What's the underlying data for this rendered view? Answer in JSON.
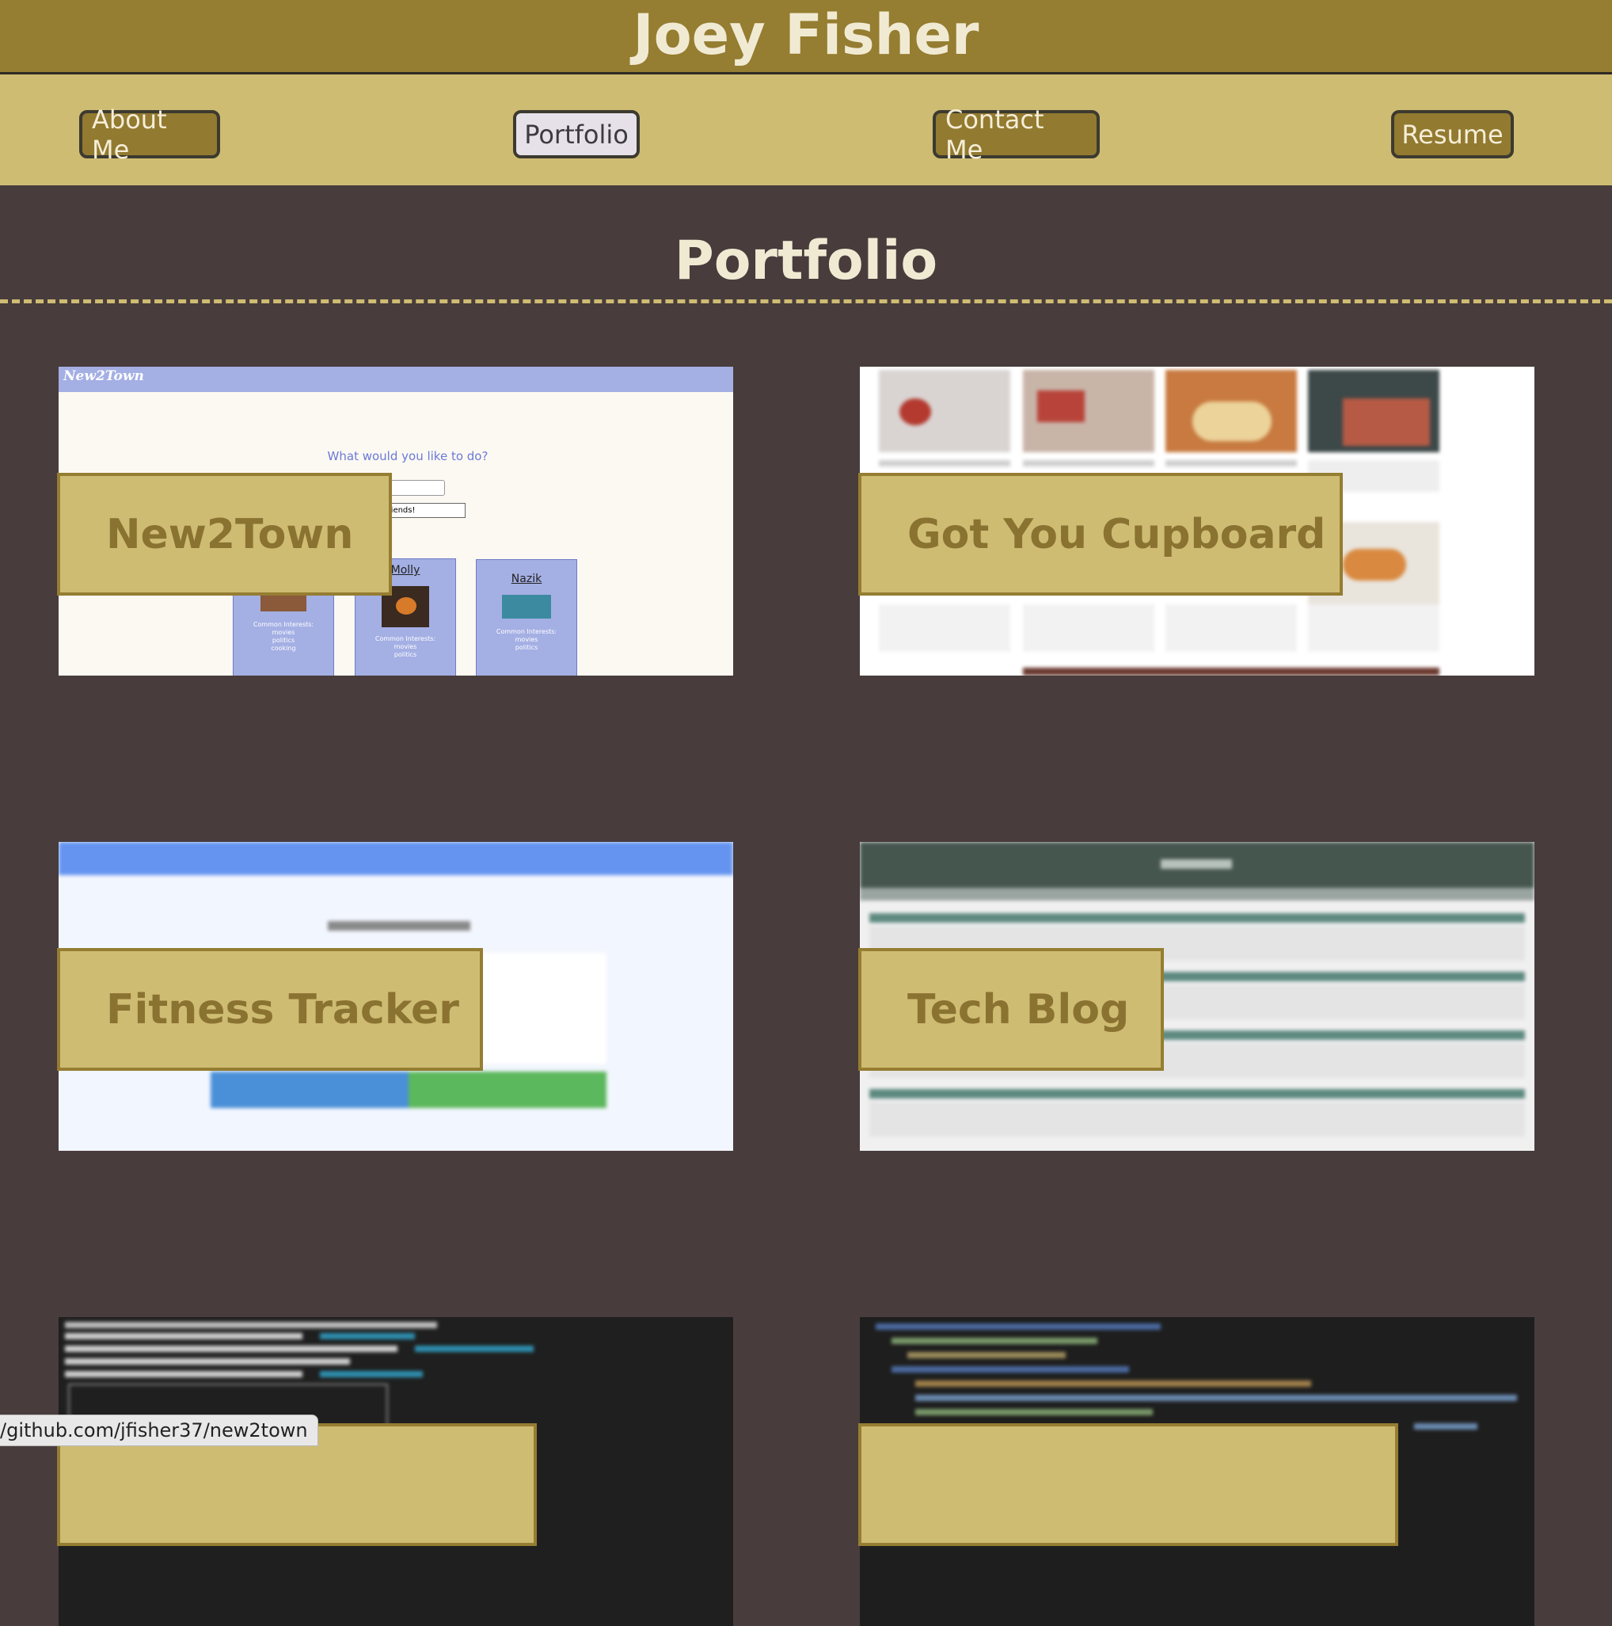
{
  "header": {
    "name": "Joey Fisher"
  },
  "nav": {
    "items": [
      {
        "label": "About Me",
        "active": false
      },
      {
        "label": "Portfolio",
        "active": true
      },
      {
        "label": "Contact Me",
        "active": false
      },
      {
        "label": "Resume",
        "active": false
      }
    ]
  },
  "section": {
    "title": "Portfolio"
  },
  "projects": [
    {
      "title": "New2Town",
      "preview": {
        "logo": "New2Town",
        "question": "What would you like to do?",
        "button": "d Friends!",
        "cards": [
          {
            "name": "Molly",
            "interests": "Common Interests:",
            "items": [
              "movies",
              "politics"
            ]
          },
          {
            "name": "Nazik",
            "interests": "Common Interests:",
            "items": [
              "movies",
              "politics"
            ]
          },
          {
            "name": "",
            "interests": "Common Interests:",
            "items": [
              "movies",
              "politics",
              "cooking"
            ]
          }
        ]
      }
    },
    {
      "title": "Got You Cupboard"
    },
    {
      "title": "Fitness Tracker"
    },
    {
      "title": "Tech Blog"
    },
    {
      "title": ""
    },
    {
      "title": ""
    }
  ],
  "status_bar": {
    "url": "/github.com/jfisher37/new2town"
  },
  "colors": {
    "header_bg": "#957d31",
    "nav_bg": "#cfbc73",
    "page_bg": "#483c3c",
    "heading_text": "#f1ead3"
  }
}
